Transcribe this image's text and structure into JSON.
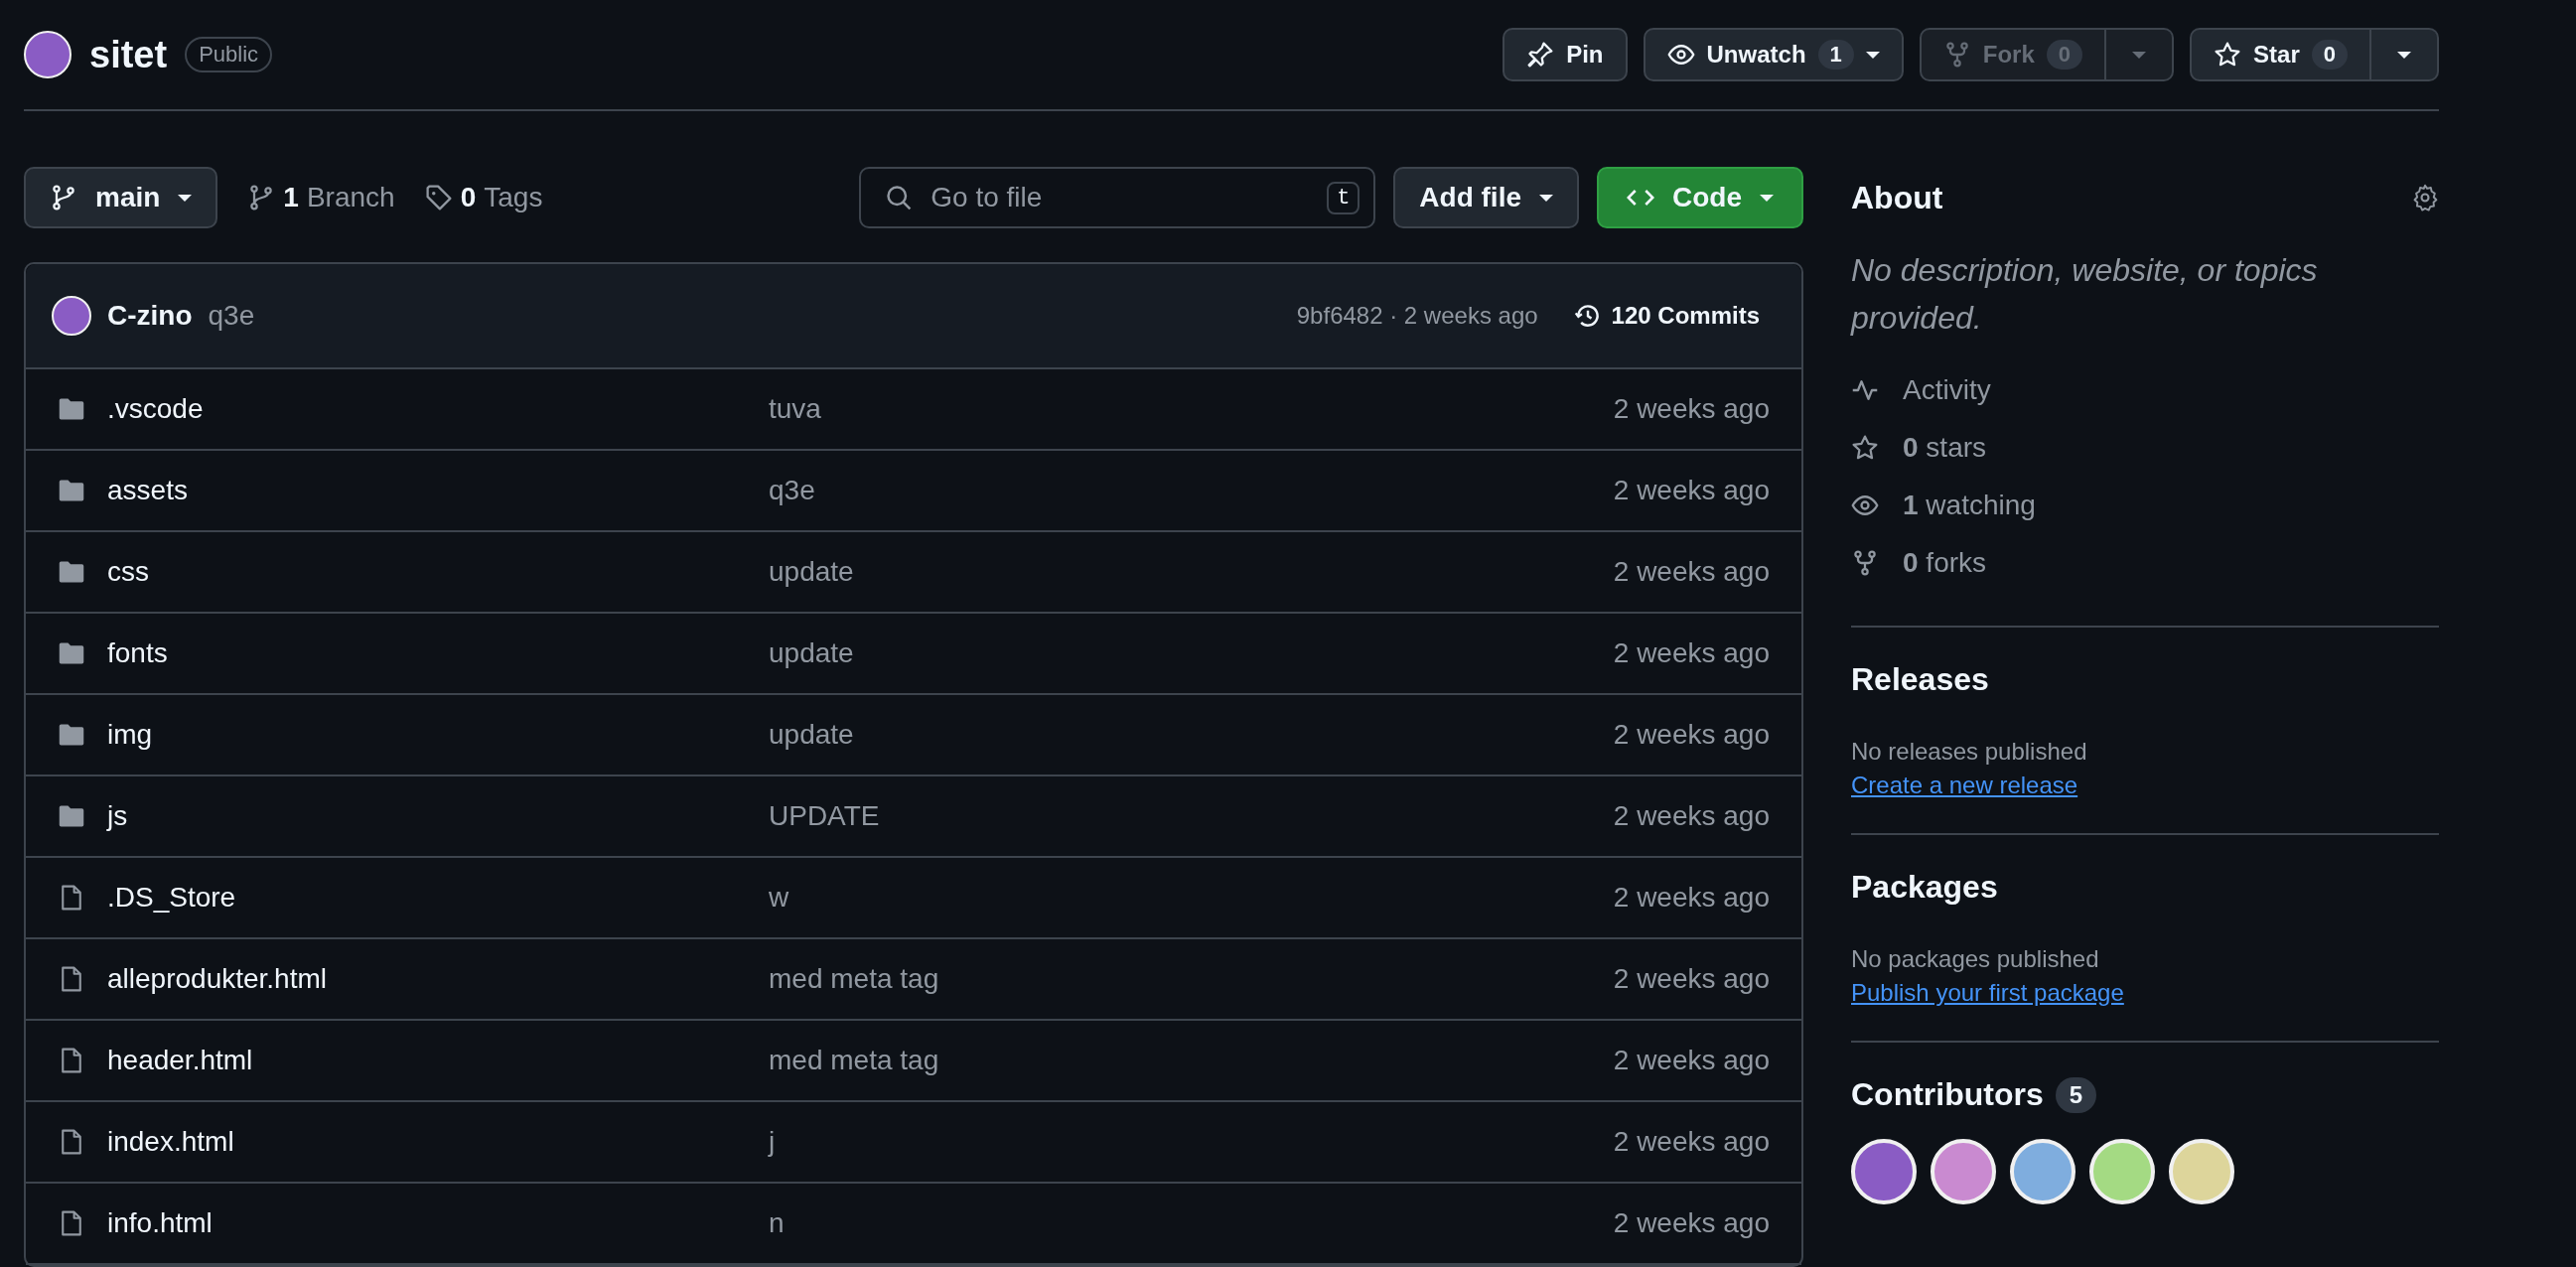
{
  "repo": {
    "name": "sitet",
    "visibility": "Public"
  },
  "actions": [
    {
      "kind": "pin",
      "label": "Pin",
      "disabled": false
    },
    {
      "kind": "watch",
      "label": "Unwatch",
      "count": "1",
      "disabled": false
    },
    {
      "kind": "fork",
      "label": "Fork",
      "count": "0",
      "disabled": true
    },
    {
      "kind": "star",
      "label": "Star",
      "count": "0",
      "disabled": false
    }
  ],
  "branch": {
    "name": "main",
    "branches_count": "1",
    "branches_label": "Branch",
    "tags_count": "0",
    "tags_label": "Tags"
  },
  "search": {
    "placeholder": "Go to file",
    "shortcut": "t"
  },
  "add_file": "Add file",
  "code": "Code",
  "commit": {
    "author": "C-zino",
    "message": "q3e",
    "hash_time": "9bf6482 · 2 weeks ago",
    "commits": "120 Commits"
  },
  "files": [
    {
      "kind": "folder",
      "name": ".vscode",
      "message": "tuva",
      "time": "2 weeks ago"
    },
    {
      "kind": "folder",
      "name": "assets",
      "message": "q3e",
      "time": "2 weeks ago"
    },
    {
      "kind": "folder",
      "name": "css",
      "message": "update",
      "time": "2 weeks ago"
    },
    {
      "kind": "folder",
      "name": "fonts",
      "message": "update",
      "time": "2 weeks ago"
    },
    {
      "kind": "folder",
      "name": "img",
      "message": "update",
      "time": "2 weeks ago"
    },
    {
      "kind": "folder",
      "name": "js",
      "message": "UPDATE",
      "time": "2 weeks ago"
    },
    {
      "kind": "file",
      "name": ".DS_Store",
      "message": "w",
      "time": "2 weeks ago"
    },
    {
      "kind": "file",
      "name": "alleprodukter.html",
      "message": "med meta tag",
      "time": "2 weeks ago"
    },
    {
      "kind": "file",
      "name": "header.html",
      "message": "med meta tag",
      "time": "2 weeks ago"
    },
    {
      "kind": "file",
      "name": "index.html",
      "message": "j",
      "time": "2 weeks ago"
    },
    {
      "kind": "file",
      "name": "info.html",
      "message": "n",
      "time": "2 weeks ago"
    }
  ],
  "about": {
    "title": "About",
    "description": "No description, website, or topics provided.",
    "stats": [
      {
        "kind": "activity",
        "text": "Activity"
      },
      {
        "kind": "stars",
        "count": "0",
        "text": "stars"
      },
      {
        "kind": "watching",
        "count": "1",
        "text": "watching"
      },
      {
        "kind": "forks",
        "count": "0",
        "text": "forks"
      }
    ]
  },
  "releases": {
    "title": "Releases",
    "note": "No releases published",
    "link": "Create a new release"
  },
  "packages": {
    "title": "Packages",
    "note": "No packages published",
    "link": "Publish your first package"
  },
  "contributors": {
    "title": "Contributors",
    "count": "5",
    "avatars": [
      {
        "color": "#8a5cc4"
      },
      {
        "color": "#c98ad0"
      },
      {
        "color": "#7fadde"
      },
      {
        "color": "#a4da83"
      },
      {
        "color": "#ddd59b"
      }
    ]
  }
}
